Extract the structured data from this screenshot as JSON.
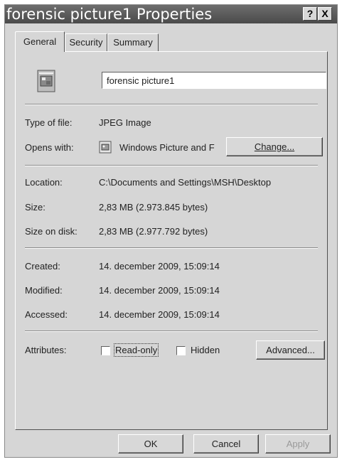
{
  "window": {
    "title": "forensic picture1 Properties",
    "help_label": "?",
    "close_label": "X"
  },
  "tabs": [
    {
      "label": "General",
      "active": true
    },
    {
      "label": "Security",
      "active": false
    },
    {
      "label": "Summary",
      "active": false
    }
  ],
  "general": {
    "file_name": "forensic picture1",
    "type_label": "Type of file:",
    "type_value": "JPEG Image",
    "opens_label": "Opens with:",
    "opens_value": "Windows Picture and F",
    "change_label": "Change...",
    "location_label": "Location:",
    "location_value": "C:\\Documents and Settings\\MSH\\Desktop",
    "size_label": "Size:",
    "size_value": "2,83 MB (2.973.845 bytes)",
    "size_disk_label": "Size on disk:",
    "size_disk_value": "2,83 MB (2.977.792 bytes)",
    "created_label": "Created:",
    "created_value": "14. december 2009, 15:09:14",
    "modified_label": "Modified:",
    "modified_value": "14. december 2009, 15:09:14",
    "accessed_label": "Accessed:",
    "accessed_value": "14. december 2009, 15:09:14",
    "attributes_label": "Attributes:",
    "readonly_label": "Read-only",
    "hidden_label": "Hidden",
    "advanced_label": "Advanced..."
  },
  "buttons": {
    "ok": "OK",
    "cancel": "Cancel",
    "apply": "Apply"
  },
  "icons": {
    "file": "image-file-icon",
    "app": "picture-viewer-icon"
  },
  "colors": {
    "titlebar": "#5a5a5a",
    "face": "#d6d6d6",
    "disabled_text": "#9a9a9a"
  }
}
